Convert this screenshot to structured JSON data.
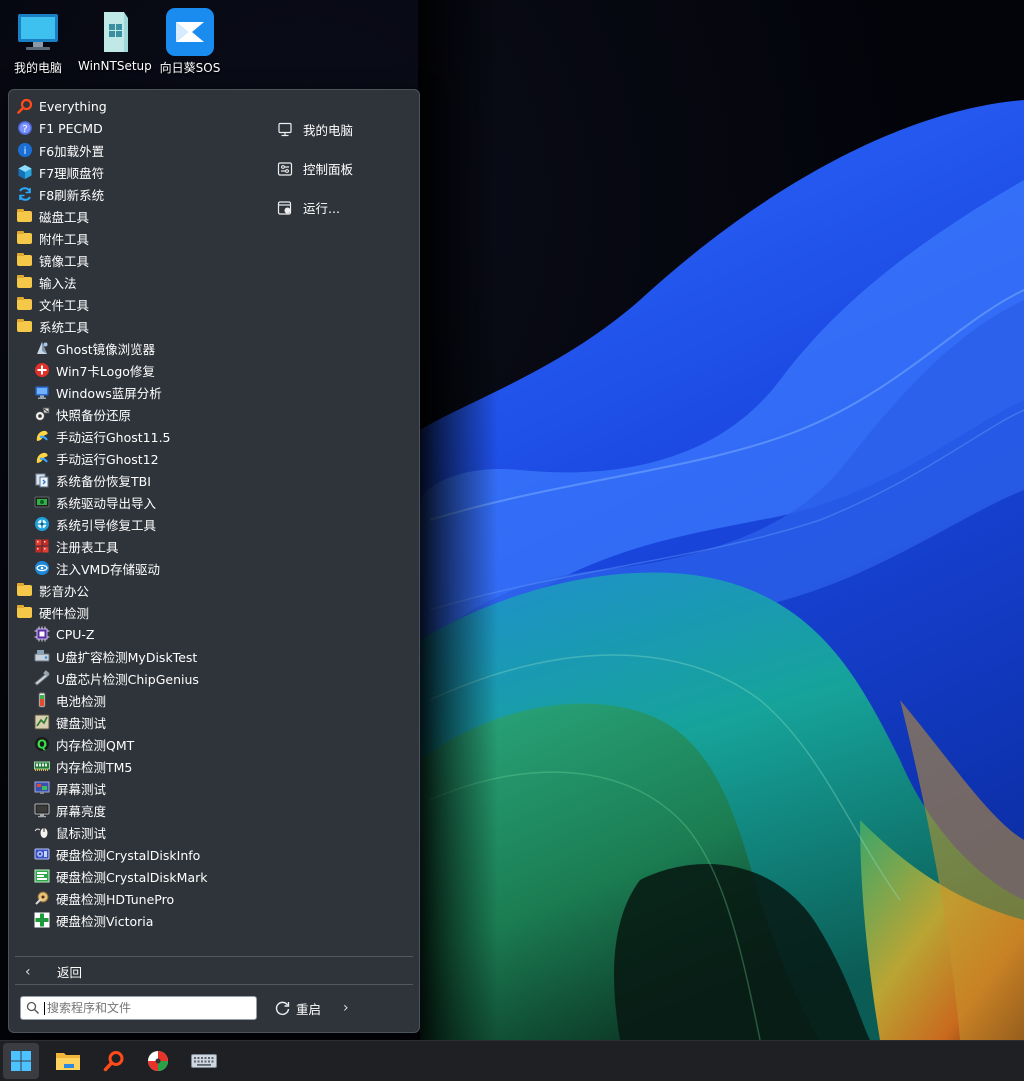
{
  "desktop": {
    "icons": [
      {
        "label": "我的电脑",
        "icon": "monitor-icon"
      },
      {
        "label": "WinNTSetup",
        "icon": "winntsetup-icon"
      },
      {
        "label": "向日葵SOS",
        "icon": "sunflower-sos-icon"
      }
    ]
  },
  "start_menu": {
    "programs": [
      {
        "label": "Everything",
        "icon": "search-magnifier-icon",
        "level": 0
      },
      {
        "label": "F1 PECMD",
        "icon": "help-icon",
        "level": 0
      },
      {
        "label": "F6加载外置",
        "icon": "info-icon",
        "level": 0
      },
      {
        "label": "F7理顺盘符",
        "icon": "cube-icon",
        "level": 0
      },
      {
        "label": "F8刷新系统",
        "icon": "refresh-icon",
        "level": 0
      },
      {
        "label": "磁盘工具",
        "icon": "folder-icon",
        "level": 0
      },
      {
        "label": "附件工具",
        "icon": "folder-icon",
        "level": 0
      },
      {
        "label": "镜像工具",
        "icon": "folder-icon",
        "level": 0
      },
      {
        "label": "输入法",
        "icon": "folder-icon",
        "level": 0
      },
      {
        "label": "文件工具",
        "icon": "folder-icon",
        "level": 0
      },
      {
        "label": "系统工具",
        "icon": "folder-icon",
        "level": 0
      },
      {
        "label": "Ghost镜像浏览器",
        "icon": "ghost-explorer-icon",
        "level": 1
      },
      {
        "label": "Win7卡Logo修复",
        "icon": "red-plus-icon",
        "level": 1
      },
      {
        "label": "Windows蓝屏分析",
        "icon": "bluescreen-icon",
        "level": 1
      },
      {
        "label": "快照备份还原",
        "icon": "snapshot-icon",
        "level": 1
      },
      {
        "label": "手动运行Ghost11.5",
        "icon": "ghost-icon",
        "level": 1
      },
      {
        "label": "手动运行Ghost12",
        "icon": "ghost-icon",
        "level": 1
      },
      {
        "label": "系统备份恢复TBI",
        "icon": "backup-icon",
        "level": 1
      },
      {
        "label": "系统驱动导出导入",
        "icon": "driver-icon",
        "level": 1
      },
      {
        "label": "系统引导修复工具",
        "icon": "boot-repair-icon",
        "level": 1
      },
      {
        "label": "注册表工具",
        "icon": "registry-icon",
        "level": 1
      },
      {
        "label": "注入VMD存储驱动",
        "icon": "vmd-icon",
        "level": 1
      },
      {
        "label": "影音办公",
        "icon": "folder-icon",
        "level": 0
      },
      {
        "label": "硬件检测",
        "icon": "folder-icon",
        "level": 0
      },
      {
        "label": "CPU-Z",
        "icon": "cpu-icon",
        "level": 1
      },
      {
        "label": "U盘扩容检测MyDiskTest",
        "icon": "usb-test-icon",
        "level": 1
      },
      {
        "label": "U盘芯片检测ChipGenius",
        "icon": "usb-chip-icon",
        "level": 1
      },
      {
        "label": "电池检测",
        "icon": "battery-icon",
        "level": 1
      },
      {
        "label": "键盘测试",
        "icon": "keyboard-test-icon",
        "level": 1
      },
      {
        "label": "内存检测QMT",
        "icon": "qmt-icon",
        "level": 1
      },
      {
        "label": "内存检测TM5",
        "icon": "memory-icon",
        "level": 1
      },
      {
        "label": "屏幕测试",
        "icon": "screen-test-icon",
        "level": 1
      },
      {
        "label": "屏幕亮度",
        "icon": "monitor-icon",
        "level": 1
      },
      {
        "label": "鼠标测试",
        "icon": "mouse-icon",
        "level": 1
      },
      {
        "label": "硬盘检测CrystalDiskInfo",
        "icon": "crystaldiskinfo-icon",
        "level": 1
      },
      {
        "label": "硬盘检测CrystalDiskMark",
        "icon": "crystaldiskmark-icon",
        "level": 1
      },
      {
        "label": "硬盘检测HDTunePro",
        "icon": "hdtune-icon",
        "level": 1
      },
      {
        "label": "硬盘检测Victoria",
        "icon": "victoria-icon",
        "level": 1
      }
    ],
    "quick_links": [
      {
        "label": "我的电脑",
        "icon": "computer-icon"
      },
      {
        "label": "控制面板",
        "icon": "control-panel-icon"
      },
      {
        "label": "运行...",
        "icon": "run-icon"
      }
    ],
    "back_label": "返回",
    "search_placeholder": "搜索程序和文件",
    "restart_label": "重启"
  },
  "taskbar": {
    "items": [
      {
        "icon": "windows-start-icon",
        "active": true
      },
      {
        "icon": "file-explorer-icon",
        "active": false
      },
      {
        "icon": "everything-search-icon",
        "active": false
      },
      {
        "icon": "disk-genius-icon",
        "active": false
      },
      {
        "icon": "keyboard-icon",
        "active": false
      }
    ]
  }
}
